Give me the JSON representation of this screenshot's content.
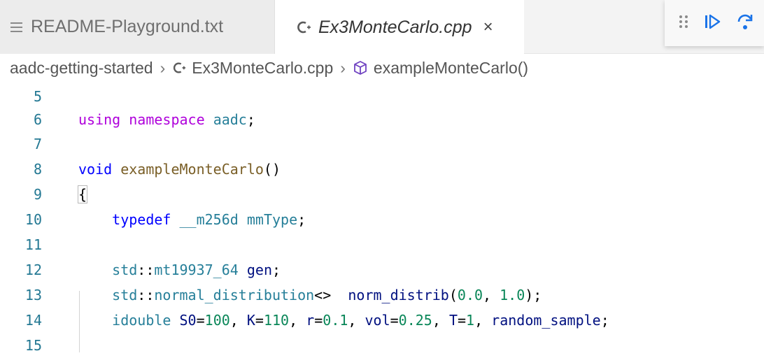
{
  "tabs": [
    {
      "label": "README-Playground.txt",
      "icon": "text-file-icon",
      "active": false
    },
    {
      "label": "Ex3MonteCarlo.cpp",
      "icon": "cpp-file-icon",
      "active": true,
      "close": "×"
    }
  ],
  "breadcrumb": [
    "aadc-getting-started",
    "Ex3MonteCarlo.cpp",
    "exampleMonteCarlo()"
  ],
  "line_numbers": [
    "5",
    "6",
    "7",
    "8",
    "9",
    "10",
    "11",
    "12",
    "13",
    "14",
    "15"
  ],
  "code": {
    "l6": [
      "using",
      "namespace",
      "aadc",
      ";"
    ],
    "l8": [
      "void",
      "exampleMonteCarlo",
      "()"
    ],
    "l9": [
      "{"
    ],
    "l10": [
      "typedef",
      "__m256d",
      "mmType",
      ";"
    ],
    "l12": [
      "std",
      "::",
      "mt19937_64",
      "gen",
      ";"
    ],
    "l13": [
      "std",
      "::",
      "normal_distribution",
      "<>",
      "norm_distrib",
      "(",
      "0.0",
      ", ",
      "1.0",
      ");"
    ],
    "l14": [
      "idouble",
      "S0",
      "=",
      "100",
      ", ",
      "K",
      "=",
      "110",
      ", ",
      "r",
      "=",
      "0.1",
      ", ",
      "vol",
      "=",
      "0.25",
      ", ",
      "T",
      "=",
      "1",
      ", ",
      "random_sample",
      ";"
    ]
  },
  "colors": {
    "keyword": "#0000ff",
    "control": "#af00db",
    "type": "#267f99",
    "function": "#795e26",
    "variable": "#001080",
    "number": "#098658",
    "line_number": "#237893"
  }
}
